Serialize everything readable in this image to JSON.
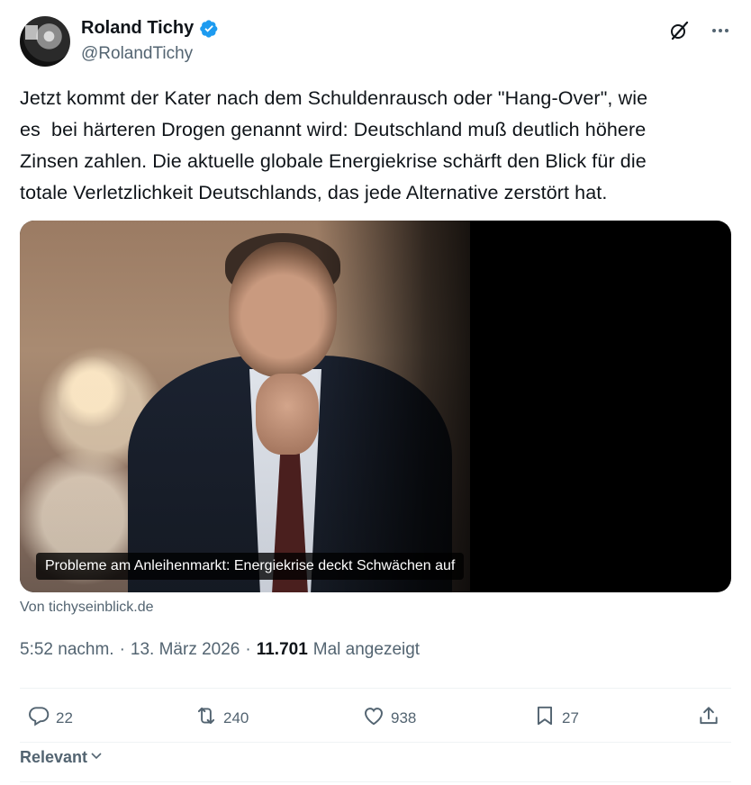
{
  "author": {
    "name": "Roland Tichy",
    "handle": "@RolandTichy"
  },
  "tweet": {
    "text": "Jetzt kommt der Kater nach dem Schuldenrausch oder \"Hang-Over\", wie\nes  bei härteren Drogen genannt wird: Deutschland muß deutlich höhere\nZinsen zahlen. Die aktuelle globale Energiekrise schärft den Blick für die\ntotale Verletzlichkeit Deutschlands, das jede Alternative zerstört hat."
  },
  "card": {
    "caption": "Probleme am Anleihenmarkt: Energiekrise deckt Schwächen auf",
    "source": "Von tichyseinblick.de"
  },
  "meta": {
    "time": "5:52 nachm.",
    "sep1": "·",
    "date": "13. März 2026",
    "sep2": "·",
    "views_count": "11.701",
    "views_label": "Mal angezeigt"
  },
  "actions": {
    "replies": "22",
    "reposts": "240",
    "likes": "938",
    "bookmarks": "27"
  },
  "sort": {
    "label": "Relevant"
  },
  "icons": [
    "verified-badge-icon",
    "grok-icon",
    "more-icon",
    "reply-icon",
    "repost-icon",
    "like-icon",
    "bookmark-icon",
    "share-icon",
    "chevron-down-icon"
  ],
  "colors": {
    "verified": "#1d9bf0",
    "text": "#0f1419",
    "secondary": "#536471"
  }
}
